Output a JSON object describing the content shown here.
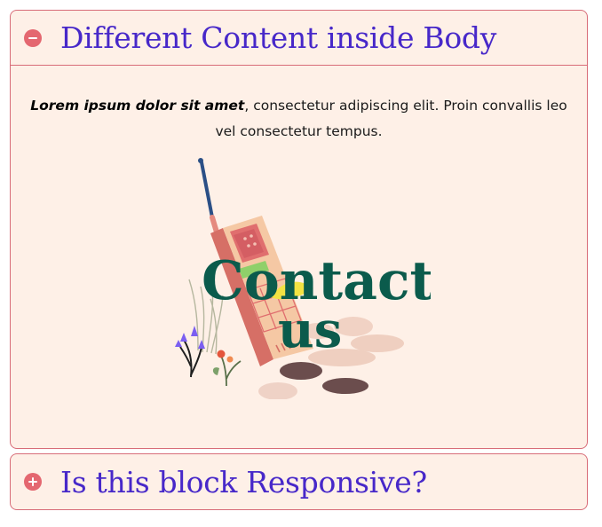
{
  "accordion": [
    {
      "title": "Different Content inside Body",
      "state": "expanded",
      "toggle_icon": "minus-circle-icon",
      "body": {
        "intro_bold": "Lorem ipsum dolor sit amet",
        "intro_rest": ", consectetur adipiscing elit. Proin convallis leo vel consectetur tempus.",
        "image": {
          "subject": "retro-mobile-phone-illustration",
          "word_1": "Contact",
          "word_2": "us"
        }
      }
    },
    {
      "title": "Is this block Responsive?",
      "state": "collapsed",
      "toggle_icon": "plus-circle-icon"
    }
  ],
  "colors": {
    "panel_background": "#fef0e7",
    "border": "#d86c78",
    "title": "#4728c9",
    "toggle_icon": "#e46770",
    "contact_text": "#0b5b4c"
  }
}
